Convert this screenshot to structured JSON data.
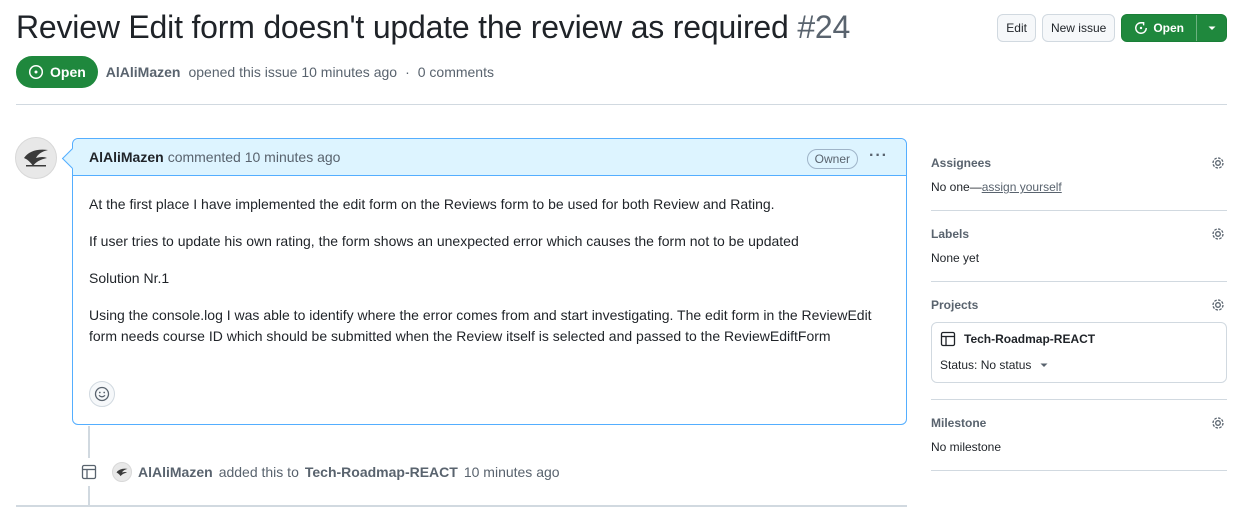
{
  "issue": {
    "title": "Review Edit form doesn't update the review as required",
    "number": "#24",
    "state": "Open",
    "author": "AlAliMazen",
    "opened_text": "opened this issue 10 minutes ago",
    "separator": "·",
    "comments_count": "0 comments"
  },
  "header_actions": {
    "edit_label": "Edit",
    "new_issue_label": "New issue",
    "open_button_label": "Open"
  },
  "comment": {
    "author": "AlAliMazen",
    "action": "commented 10 minutes ago",
    "role_badge": "Owner",
    "menu_label": "···",
    "paragraphs": [
      "At the first place I have implemented the edit form on the Reviews form to be used for both Review and Rating.",
      "If user tries to update his own rating, the form shows an unexpected error which causes the form not to be updated",
      "Solution Nr.1",
      "Using the console.log I was able to identify where the error comes from and start investigating. The edit form in the ReviewEdit form needs course ID which should be submitted when the Review itself is selected and passed to the ReviewEdiftForm"
    ]
  },
  "timeline": {
    "actor": "AlAliMazen",
    "action": "added this to",
    "project": "Tech-Roadmap-REACT",
    "time": "10 minutes ago"
  },
  "sidebar": {
    "assignees": {
      "heading": "Assignees",
      "value": "No one—",
      "link": "assign yourself"
    },
    "labels": {
      "heading": "Labels",
      "value": "None yet"
    },
    "projects": {
      "heading": "Projects",
      "project_name": "Tech-Roadmap-REACT",
      "status_label": "Status: No status"
    },
    "milestone": {
      "heading": "Milestone",
      "value": "No milestone"
    }
  },
  "colors": {
    "open_green": "#1f883d",
    "comment_header_bg": "#ddf4ff",
    "comment_border": "#54aeff",
    "muted_text": "#59636e",
    "divider": "#d1d9e0"
  }
}
